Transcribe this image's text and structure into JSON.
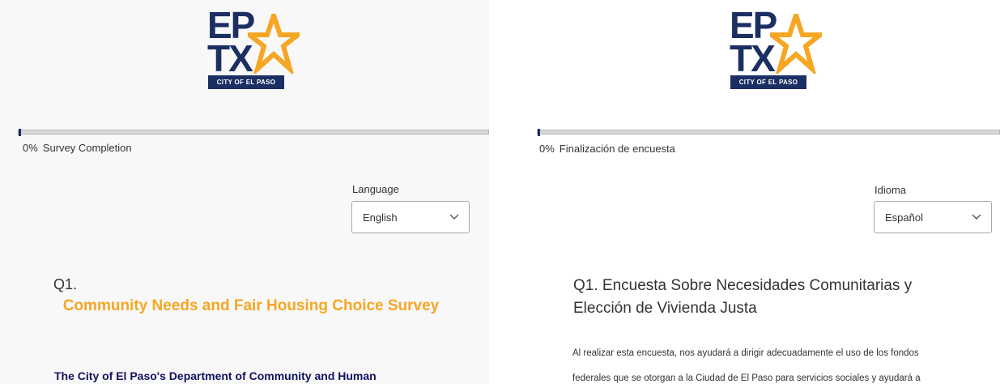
{
  "logo": {
    "line1": "EP",
    "line2": "TX",
    "city": "CITY OF EL PASO"
  },
  "colors": {
    "navy": "#1c2f63",
    "gold": "#f5a623",
    "text": "#333333"
  },
  "en": {
    "progress": {
      "percent": "0%",
      "label": "Survey Completion",
      "value": 0
    },
    "language": {
      "label": "Language",
      "selected": "English",
      "icon": "chevron-down-icon"
    },
    "question": {
      "number": "Q1.",
      "title": "Community Needs and Fair Housing Choice Survey",
      "intro": "The City of El Paso's Department of Community and Human"
    }
  },
  "es": {
    "progress": {
      "percent": "0%",
      "label": "Finalización de encuesta",
      "value": 0
    },
    "language": {
      "label": "Idioma",
      "selected": "Español",
      "icon": "chevron-down-icon"
    },
    "question": {
      "title": "Q1. Encuesta Sobre Necesidades Comunitarias y Elección de Vivienda Justa",
      "body_line1": "Al realizar esta encuesta, nos ayudará a dirigir adecuadamente el uso de los fondos",
      "body_line2": "federales que se otorgan a la Ciudad de El Paso para servicios sociales y ayudará a"
    }
  }
}
